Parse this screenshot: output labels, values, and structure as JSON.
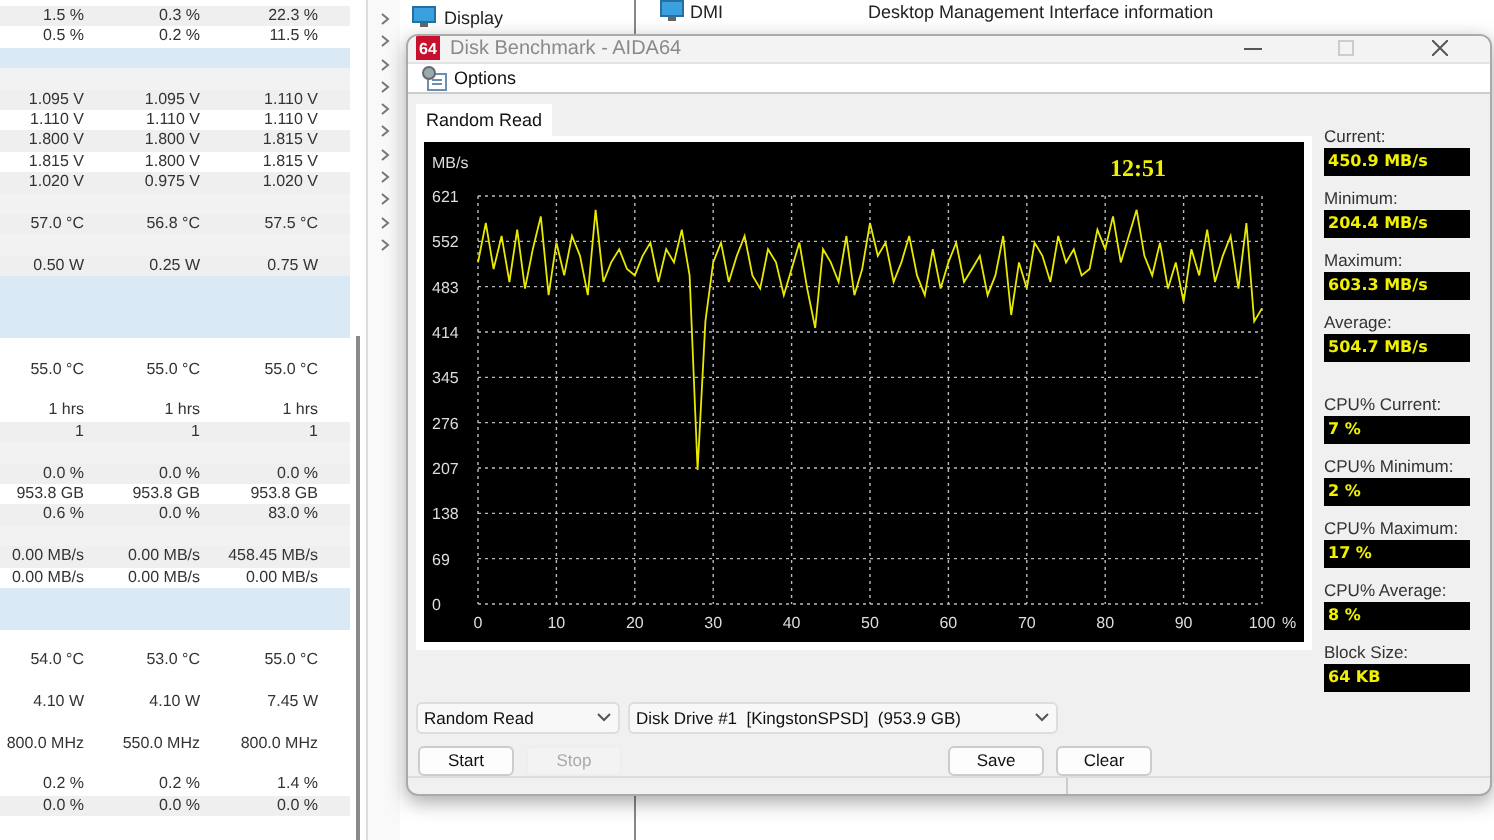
{
  "background": {
    "tree": [
      {
        "label": "Display"
      }
    ],
    "list": [
      {
        "name": "DMI",
        "description": "Desktop Management Interface information"
      }
    ]
  },
  "sensor_table": {
    "rows": [
      {
        "kind": "data",
        "cells": [
          "1.5 %",
          "0.3 %",
          "22.3 %"
        ]
      },
      {
        "kind": "data",
        "cells": [
          "0.5 %",
          "0.2 %",
          "11.5 %"
        ]
      },
      {
        "kind": "section"
      },
      {
        "kind": "blank"
      },
      {
        "kind": "data",
        "cells": [
          "1.095 V",
          "1.095 V",
          "1.110 V"
        ]
      },
      {
        "kind": "data",
        "cells": [
          "1.110 V",
          "1.110 V",
          "1.110 V"
        ]
      },
      {
        "kind": "data",
        "cells": [
          "1.800 V",
          "1.800 V",
          "1.815 V"
        ]
      },
      {
        "kind": "data",
        "cells": [
          "1.815 V",
          "1.800 V",
          "1.815 V"
        ]
      },
      {
        "kind": "data",
        "cells": [
          "1.020 V",
          "0.975 V",
          "1.020 V"
        ]
      },
      {
        "kind": "blank"
      },
      {
        "kind": "data",
        "cells": [
          "57.0 °C",
          "56.8 °C",
          "57.5 °C"
        ]
      },
      {
        "kind": "blank"
      },
      {
        "kind": "data",
        "cells": [
          "0.50 W",
          "0.25 W",
          "0.75 W"
        ]
      },
      {
        "kind": "section"
      },
      {
        "kind": "section"
      },
      {
        "kind": "section"
      },
      {
        "kind": "blank"
      },
      {
        "kind": "data",
        "cells": [
          "55.0 °C",
          "55.0 °C",
          "55.0 °C"
        ]
      },
      {
        "kind": "blank"
      },
      {
        "kind": "data",
        "cells": [
          "1 hrs",
          "1 hrs",
          "1 hrs"
        ]
      },
      {
        "kind": "data",
        "cells": [
          "1",
          "1",
          "1"
        ]
      },
      {
        "kind": "blank"
      },
      {
        "kind": "data",
        "cells": [
          "0.0 %",
          "0.0 %",
          "0.0 %"
        ]
      },
      {
        "kind": "data",
        "cells": [
          "953.8 GB",
          "953.8 GB",
          "953.8 GB"
        ]
      },
      {
        "kind": "data",
        "cells": [
          "0.6 %",
          "0.0 %",
          "83.0 %"
        ]
      },
      {
        "kind": "blank"
      },
      {
        "kind": "data",
        "cells": [
          "0.00 MB/s",
          "0.00 MB/s",
          "458.45 MB/s"
        ]
      },
      {
        "kind": "data",
        "cells": [
          "0.00 MB/s",
          "0.00 MB/s",
          "0.00 MB/s"
        ]
      },
      {
        "kind": "section"
      },
      {
        "kind": "section"
      },
      {
        "kind": "blank"
      },
      {
        "kind": "data",
        "cells": [
          "54.0 °C",
          "53.0 °C",
          "55.0 °C"
        ]
      },
      {
        "kind": "blank"
      },
      {
        "kind": "data",
        "cells": [
          "4.10 W",
          "4.10 W",
          "7.45 W"
        ]
      },
      {
        "kind": "blank"
      },
      {
        "kind": "data",
        "cells": [
          "800.0 MHz",
          "550.0 MHz",
          "800.0 MHz"
        ]
      },
      {
        "kind": "blank"
      },
      {
        "kind": "data",
        "cells": [
          "0.2 %",
          "0.2 %",
          "1.4 %"
        ]
      },
      {
        "kind": "data",
        "cells": [
          "0.0 %",
          "0.0 %",
          "0.0 %"
        ]
      }
    ]
  },
  "dialog": {
    "logo": "64",
    "title": "Disk Benchmark - AIDA64",
    "toolbar": [
      {
        "label": "Options"
      }
    ],
    "tabs": [
      {
        "label": "Random Read",
        "selected": true
      }
    ],
    "clock": "12:51",
    "chart_data": {
      "type": "line",
      "grid": true,
      "xlabel": "%",
      "ylabel": "MB/s",
      "xlim": [
        0,
        100
      ],
      "ylim": [
        0,
        621
      ],
      "xticks": [
        0,
        10,
        20,
        30,
        40,
        50,
        60,
        70,
        80,
        90,
        100
      ],
      "yticks": [
        0,
        69,
        138,
        207,
        276,
        345,
        414,
        483,
        552,
        621
      ],
      "x": [
        0,
        1,
        2,
        3,
        4,
        5,
        6,
        7,
        8,
        9,
        10,
        11,
        12,
        13,
        14,
        15,
        16,
        17,
        18,
        19,
        20,
        21,
        22,
        23,
        24,
        25,
        26,
        27,
        28,
        29,
        30,
        31,
        32,
        33,
        34,
        35,
        36,
        37,
        38,
        39,
        40,
        41,
        42,
        43,
        44,
        45,
        46,
        47,
        48,
        49,
        50,
        51,
        52,
        53,
        54,
        55,
        56,
        57,
        58,
        59,
        60,
        61,
        62,
        63,
        64,
        65,
        66,
        67,
        68,
        69,
        70,
        71,
        72,
        73,
        74,
        75,
        76,
        77,
        78,
        79,
        80,
        81,
        82,
        83,
        84,
        85,
        86,
        87,
        88,
        89,
        90,
        91,
        92,
        93,
        94,
        95,
        96,
        97,
        98,
        99,
        100
      ],
      "series": [
        {
          "color": "#e8e800",
          "values": [
            520,
            580,
            510,
            560,
            490,
            570,
            480,
            540,
            590,
            470,
            550,
            500,
            560,
            530,
            470,
            600,
            490,
            520,
            540,
            510,
            500,
            530,
            550,
            490,
            540,
            520,
            570,
            500,
            204,
            430,
            520,
            550,
            490,
            530,
            560,
            500,
            480,
            540,
            520,
            470,
            510,
            550,
            480,
            420,
            540,
            520,
            490,
            560,
            470,
            510,
            580,
            530,
            550,
            490,
            520,
            560,
            500,
            470,
            540,
            480,
            520,
            550,
            490,
            510,
            530,
            470,
            500,
            560,
            440,
            520,
            480,
            550,
            530,
            490,
            560,
            520,
            540,
            500,
            510,
            570,
            540,
            590,
            520,
            560,
            600,
            530,
            500,
            550,
            480,
            520,
            460,
            540,
            500,
            570,
            490,
            530,
            560,
            480,
            580,
            430,
            450
          ]
        }
      ]
    },
    "stat_groups": [
      [
        {
          "label": "Current:",
          "value": "450.9 MB/s"
        },
        {
          "label": "Minimum:",
          "value": "204.4 MB/s"
        },
        {
          "label": "Maximum:",
          "value": "603.3 MB/s"
        },
        {
          "label": "Average:",
          "value": "504.7 MB/s"
        }
      ],
      [
        {
          "label": "CPU% Current:",
          "value": "7 %"
        },
        {
          "label": "CPU% Minimum:",
          "value": "2 %"
        },
        {
          "label": "CPU% Maximum:",
          "value": "17 %"
        },
        {
          "label": "CPU% Average:",
          "value": "8 %"
        },
        {
          "label": "Block Size:",
          "value": "64 KB"
        }
      ]
    ],
    "test_select": "Random Read",
    "drive_select": "Disk Drive #1  [KingstonSPSD]  (953.9 GB)",
    "left_buttons": [
      {
        "label": "Start",
        "disabled": false
      },
      {
        "label": "Stop",
        "disabled": true
      }
    ],
    "right_buttons": [
      {
        "label": "Save",
        "disabled": false
      },
      {
        "label": "Clear",
        "disabled": false
      }
    ]
  }
}
